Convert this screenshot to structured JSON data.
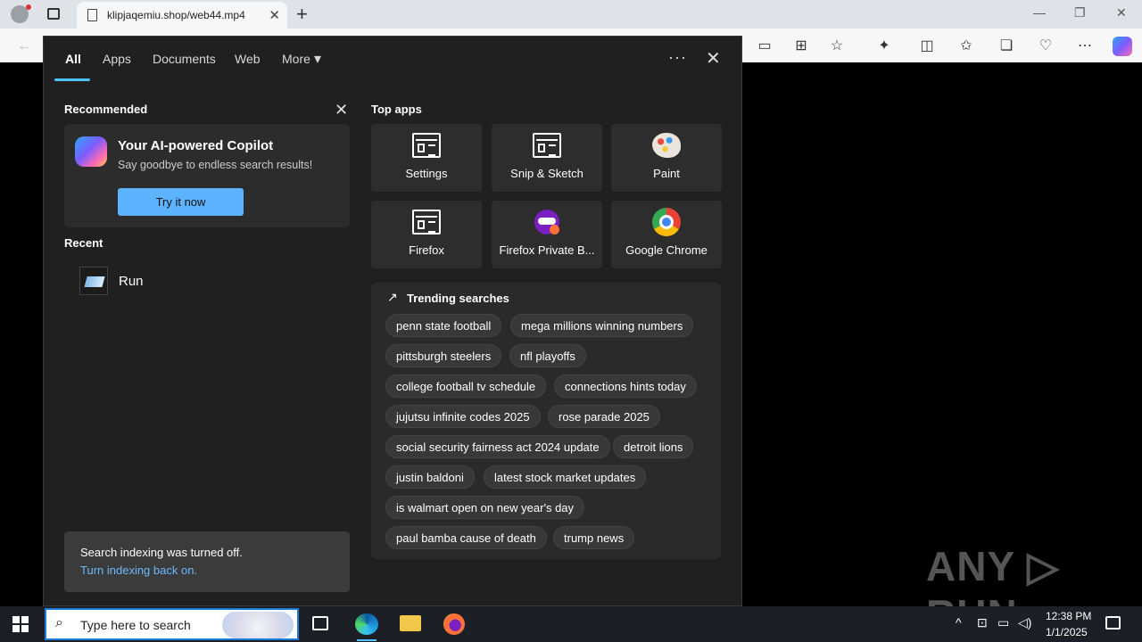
{
  "browser": {
    "tab_title": "klipjaqemiu.shop/web44.mp4",
    "tab_close": "✕",
    "new_tab": "+"
  },
  "search_panel": {
    "filters": [
      "All",
      "Apps",
      "Documents",
      "Web",
      "More"
    ],
    "more_caret": "▾",
    "menu_dots": "···",
    "close": "✕",
    "recommended": {
      "heading": "Recommended",
      "title": "Your AI-powered Copilot",
      "subtitle": "Say goodbye to endless search results!",
      "button": "Try it now",
      "close": "✕"
    },
    "recent": {
      "heading": "Recent",
      "items": [
        "Run"
      ]
    },
    "indexing": {
      "message": "Search indexing was turned off.",
      "link": "Turn indexing back on."
    },
    "top_apps": {
      "heading": "Top apps",
      "apps": [
        "Settings",
        "Snip & Sketch",
        "Paint",
        "Firefox",
        "Firefox Private B...",
        "Google Chrome"
      ]
    },
    "trending": {
      "heading": "Trending searches",
      "icon": "↗",
      "chips": [
        "penn state football",
        "mega millions winning numbers",
        "pittsburgh steelers",
        "nfl playoffs",
        "college football tv schedule",
        "connections hints today",
        "jujutsu infinite codes 2025",
        "rose parade 2025",
        "social security fairness act 2024 update",
        "detroit lions",
        "justin baldoni",
        "latest stock market updates",
        "is walmart open on new year's day",
        "paul bamba cause of death",
        "trump news"
      ]
    }
  },
  "watermark": "ANY ▷ RUN",
  "taskbar": {
    "search_placeholder": "Type here to search",
    "time": "12:38 PM",
    "date": "1/1/2025"
  },
  "colors": {
    "accent": "#4cc2ff",
    "button": "#5eb3ff",
    "link": "#6cb8ff",
    "panel_bg": "#202020"
  }
}
